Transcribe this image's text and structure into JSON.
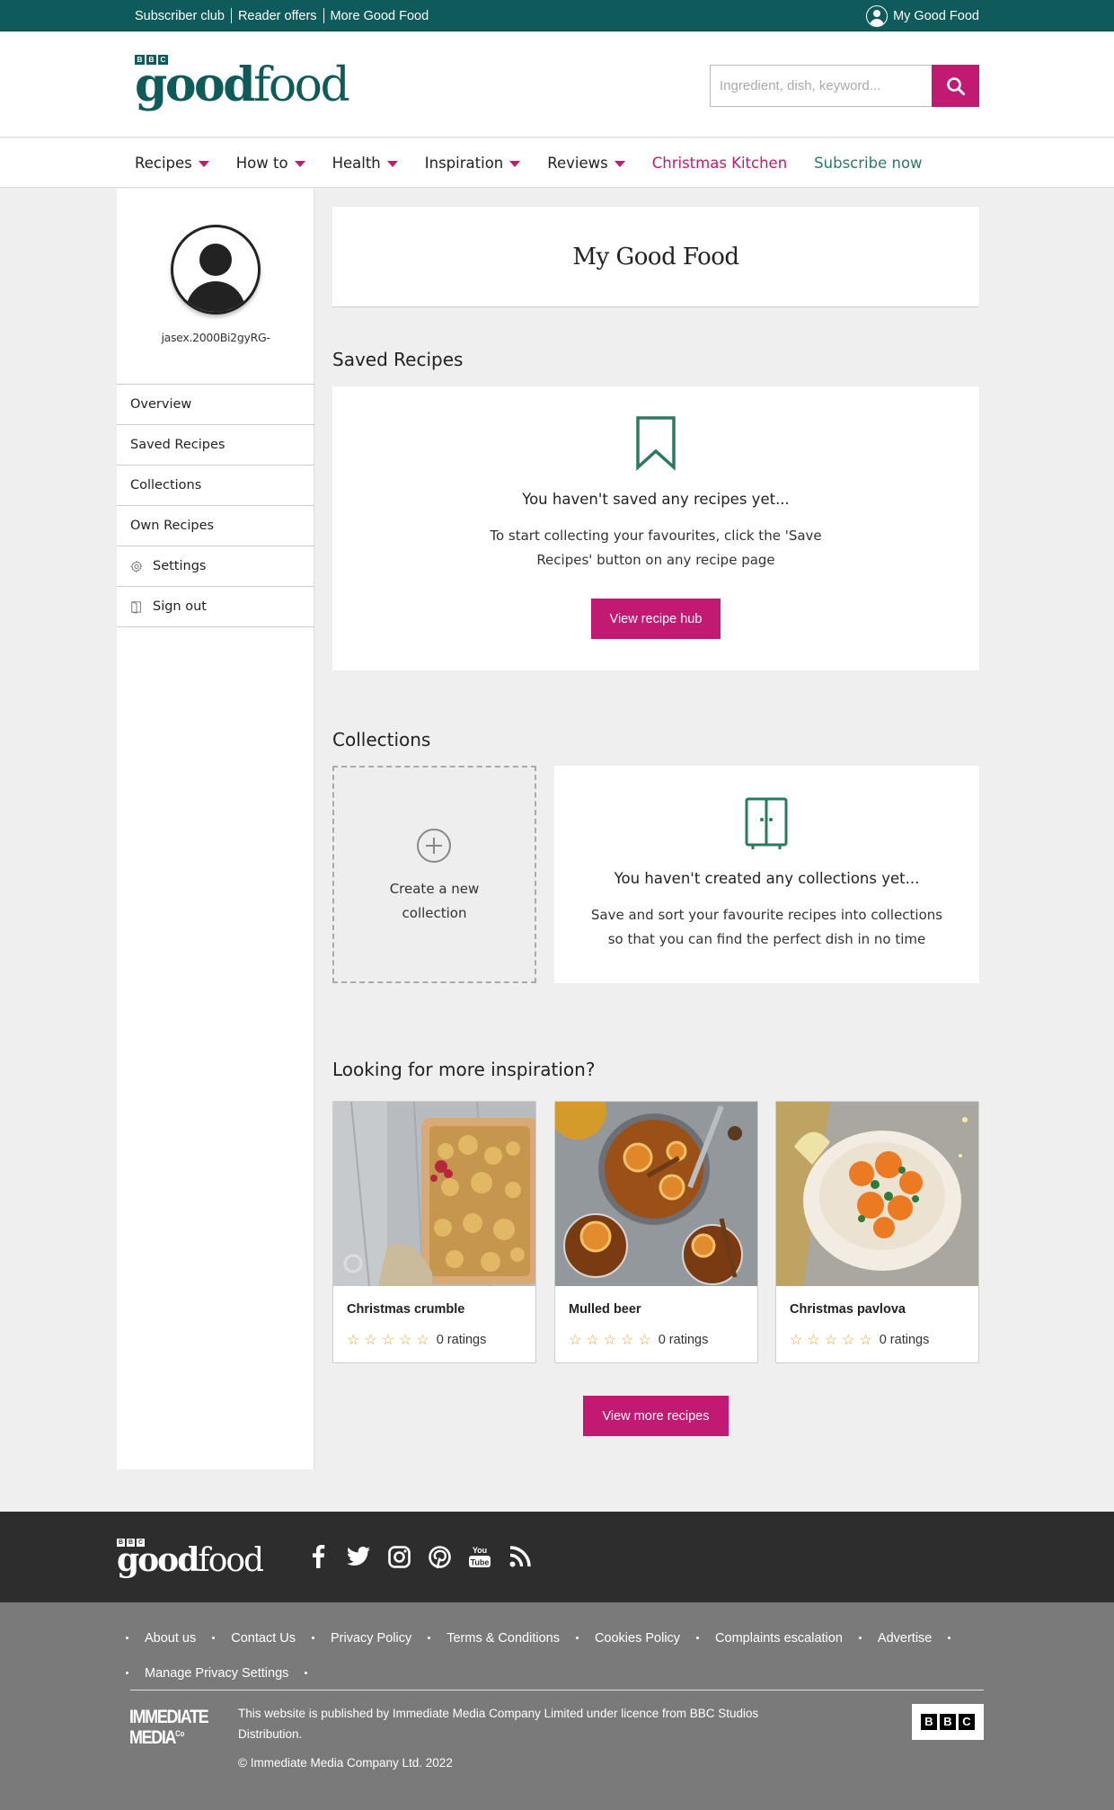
{
  "topbar": {
    "links": [
      "Subscriber club",
      "Reader offers",
      "More Good Food"
    ],
    "user_label": "My Good Food",
    "bg_color": "#0f5a5a"
  },
  "header": {
    "logo_bbc": [
      "B",
      "B",
      "C"
    ],
    "logo_good": "good",
    "logo_food": "food",
    "search_placeholder": "Ingredient, dish, keyword...",
    "search_icon": "search-icon",
    "accent_color": "#c21a72"
  },
  "nav": {
    "items": [
      {
        "label": "Recipes",
        "dropdown": true
      },
      {
        "label": "How to",
        "dropdown": true
      },
      {
        "label": "Health",
        "dropdown": true
      },
      {
        "label": "Inspiration",
        "dropdown": true
      },
      {
        "label": "Reviews",
        "dropdown": true
      },
      {
        "label": "Christmas Kitchen",
        "color": "#c21a72"
      },
      {
        "label": "Subscribe now",
        "color": "#2a7a62"
      }
    ]
  },
  "sidebar": {
    "username": "jasex.2000Bi2gyRG-",
    "items": [
      {
        "label": "Overview"
      },
      {
        "label": "Saved Recipes"
      },
      {
        "label": "Collections"
      },
      {
        "label": "Own Recipes"
      },
      {
        "label": "Settings",
        "icon": "gear-icon"
      },
      {
        "label": "Sign out",
        "icon": "door-icon"
      }
    ]
  },
  "main": {
    "title": "My Good Food",
    "saved": {
      "heading": "Saved Recipes",
      "empty_title": "You haven't saved any recipes yet...",
      "empty_line1": "To start collecting your favourites, click the 'Save",
      "empty_line2": "Recipes' button on any recipe page",
      "button": "View recipe hub"
    },
    "collections": {
      "heading": "Collections",
      "create_line1": "Create a new",
      "create_line2": "collection",
      "empty_title": "You haven't created any collections yet...",
      "empty_line1": "Save and sort your favourite recipes into collections",
      "empty_line2": "so that you can find the perfect dish in no time"
    },
    "inspiration": {
      "heading": "Looking for more inspiration?",
      "recipes": [
        {
          "name": "Christmas crumble",
          "rating_text": "0 ratings",
          "stars": 0
        },
        {
          "name": "Mulled beer",
          "rating_text": "0 ratings",
          "stars": 0
        },
        {
          "name": "Christmas pavlova",
          "rating_text": "0 ratings",
          "stars": 0
        }
      ],
      "button": "View more recipes"
    }
  },
  "footer": {
    "logo_good": "good",
    "logo_food": "food",
    "socials": [
      "facebook-icon",
      "twitter-icon",
      "instagram-icon",
      "pinterest-icon",
      "youtube-icon",
      "rss-icon"
    ],
    "youtube_text": "You Tube",
    "links": [
      "About us",
      "Contact Us",
      "Privacy Policy",
      "Terms & Conditions",
      "Cookies Policy",
      "Complaints escalation",
      "Advertise",
      "Manage Privacy Settings"
    ],
    "publisher_line1": "IMMEDIATE",
    "publisher_line2": "MEDIA",
    "publisher_co": "Co",
    "licence_text": "This website is published by Immediate Media Company Limited under licence from BBC Studios Distribution.",
    "copyright": "© Immediate Media Company Ltd. 2022",
    "bbc_letters": [
      "B",
      "B",
      "C"
    ]
  }
}
